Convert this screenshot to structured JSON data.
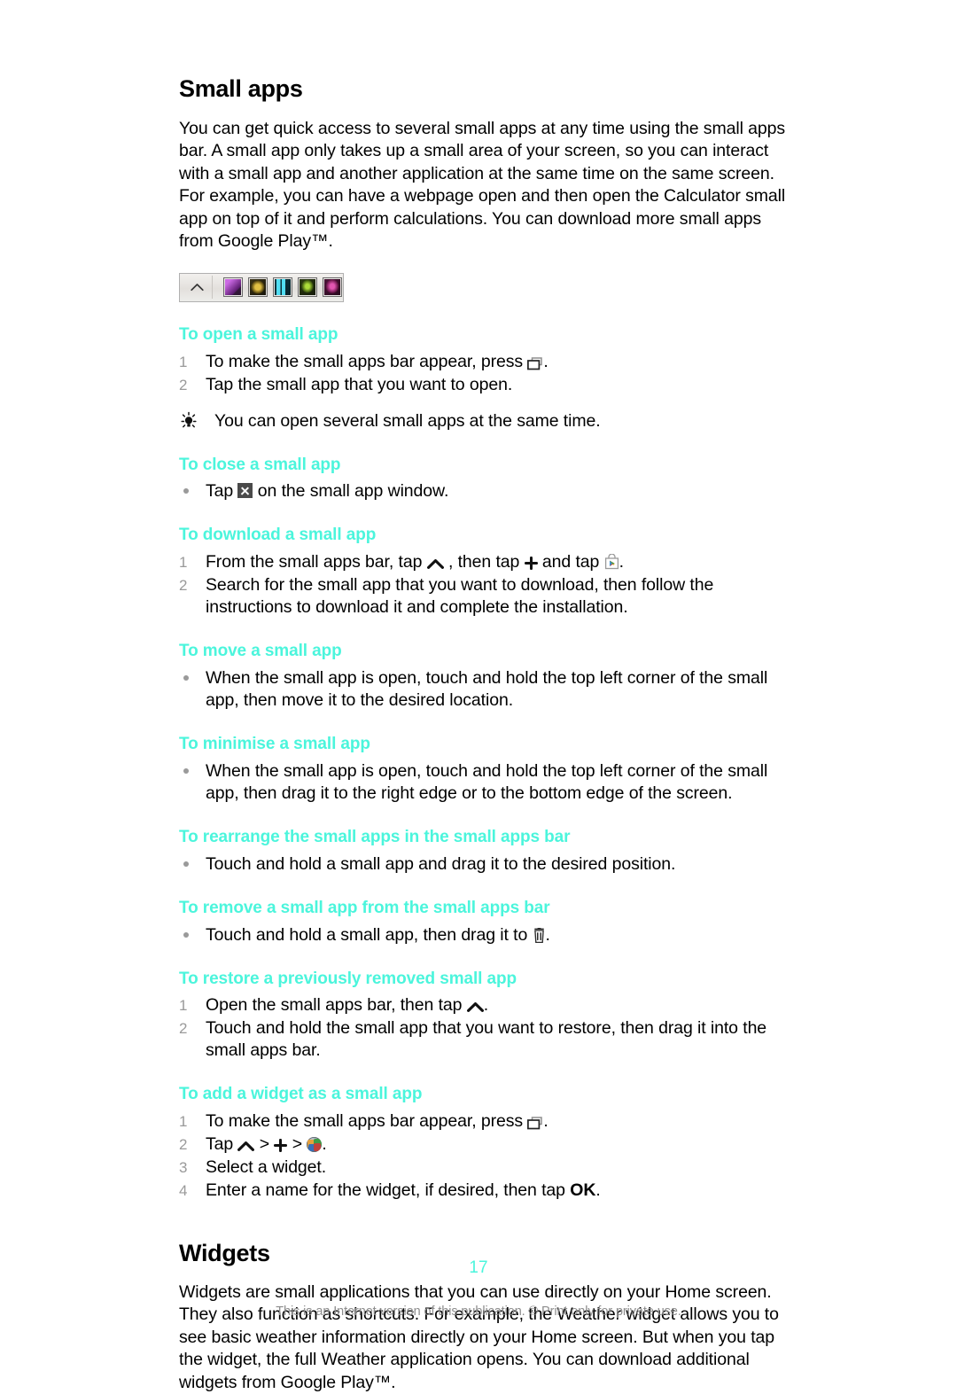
{
  "colors": {
    "accent_cyan": "#4BF5DC",
    "list_number_gray": "#9A9A9A",
    "footer_gray": "#8E8E8E",
    "body_black": "#000000"
  },
  "sections": {
    "small_apps": {
      "title": "Small apps",
      "intro": "You can get quick access to several small apps at any time using the small apps bar. A small app only takes up a small area of your screen, so you can interact with a small app and another application at the same time on the same screen. For example, you can have a webpage open and then open the Calculator small app on top of it and perform calculations. You can download more small apps from Google Play™."
    },
    "widgets": {
      "title": "Widgets",
      "intro": "Widgets are small applications that you can use directly on your Home screen. They also function as shortcuts. For example, the Weather widget allows you to see basic weather information directly on your Home screen. But when you tap the widget, the full Weather application opens. You can download additional widgets from Google Play™."
    }
  },
  "small_apps_bar": {
    "chevron_icon": "chevron-up-icon",
    "apps": [
      {
        "name": "small-app-icon-1",
        "color": "#b44cc4"
      },
      {
        "name": "small-app-icon-2",
        "color": "#c9a23a"
      },
      {
        "name": "small-app-icon-3",
        "color": "#3fc6de"
      },
      {
        "name": "small-app-icon-4",
        "color": "#9bcf3a"
      },
      {
        "name": "small-app-icon-5",
        "color": "#d9479f"
      }
    ]
  },
  "tasks": {
    "open": {
      "heading": "To open a small app",
      "steps": [
        {
          "num": "1",
          "pre": "To make the small apps bar appear, press ",
          "icon": "recents-icon",
          "post": "."
        },
        {
          "num": "2",
          "pre": "Tap the small app that you want to open.",
          "icon": "",
          "post": ""
        }
      ],
      "tip": "You can open several small apps at the same time."
    },
    "close": {
      "heading": "To close a small app",
      "bullets": [
        {
          "pre": "Tap ",
          "icon": "close-x-icon",
          "post": " on the small app window."
        }
      ]
    },
    "download": {
      "heading": "To download a small app",
      "steps": [
        {
          "num": "1",
          "pre": "From the small apps bar, tap ",
          "icon": "chevron-up-icon",
          "mid": " , then tap ",
          "icon2": "plus-icon",
          "mid2": " and tap ",
          "icon3": "play-store-icon",
          "post": "."
        },
        {
          "num": "2",
          "pre": "Search for the small app that you want to download, then follow the instructions to download it and complete the installation.",
          "icon": "",
          "post": ""
        }
      ]
    },
    "move": {
      "heading": "To move a small app",
      "bullets": [
        {
          "pre": "When the small app is open, touch and hold the top left corner of the small app, then move it to the desired location.",
          "icon": "",
          "post": ""
        }
      ]
    },
    "minimise": {
      "heading": "To minimise a small app",
      "bullets": [
        {
          "pre": "When the small app is open, touch and hold the top left corner of the small app, then drag it to the right edge or to the bottom edge of the screen.",
          "icon": "",
          "post": ""
        }
      ]
    },
    "rearrange": {
      "heading": "To rearrange the small apps in the small apps bar",
      "bullets": [
        {
          "pre": "Touch and hold a small app and drag it to the desired position.",
          "icon": "",
          "post": ""
        }
      ]
    },
    "remove": {
      "heading": "To remove a small app from the small apps bar",
      "bullets": [
        {
          "pre": "Touch and hold a small app, then drag it to ",
          "icon": "trash-icon",
          "post": "."
        }
      ]
    },
    "restore": {
      "heading": "To restore a previously removed small app",
      "steps": [
        {
          "num": "1",
          "pre": "Open the small apps bar, then tap ",
          "icon": "chevron-up-icon",
          "post": "."
        },
        {
          "num": "2",
          "pre": "Touch and hold the small app that you want to restore, then drag it into the small apps bar.",
          "icon": "",
          "post": ""
        }
      ]
    },
    "add_widget": {
      "heading": "To add a widget as a small app",
      "steps": [
        {
          "num": "1",
          "pre": "To make the small apps bar appear, press ",
          "icon": "recents-icon",
          "post": "."
        },
        {
          "num": "2",
          "pre": "Tap ",
          "icon": "chevron-up-icon",
          "mid": " > ",
          "icon2": "plus-icon",
          "mid2": " > ",
          "icon3": "widget-globe-icon",
          "post": "."
        },
        {
          "num": "3",
          "pre": "Select a widget.",
          "icon": "",
          "post": ""
        },
        {
          "num": "4",
          "pre": "Enter a name for the widget, if desired, then tap ",
          "bold": "OK",
          "post": "."
        }
      ]
    }
  },
  "footer": {
    "page_number": "17",
    "note": "This is an Internet version of this publication. © Print only for private use."
  }
}
